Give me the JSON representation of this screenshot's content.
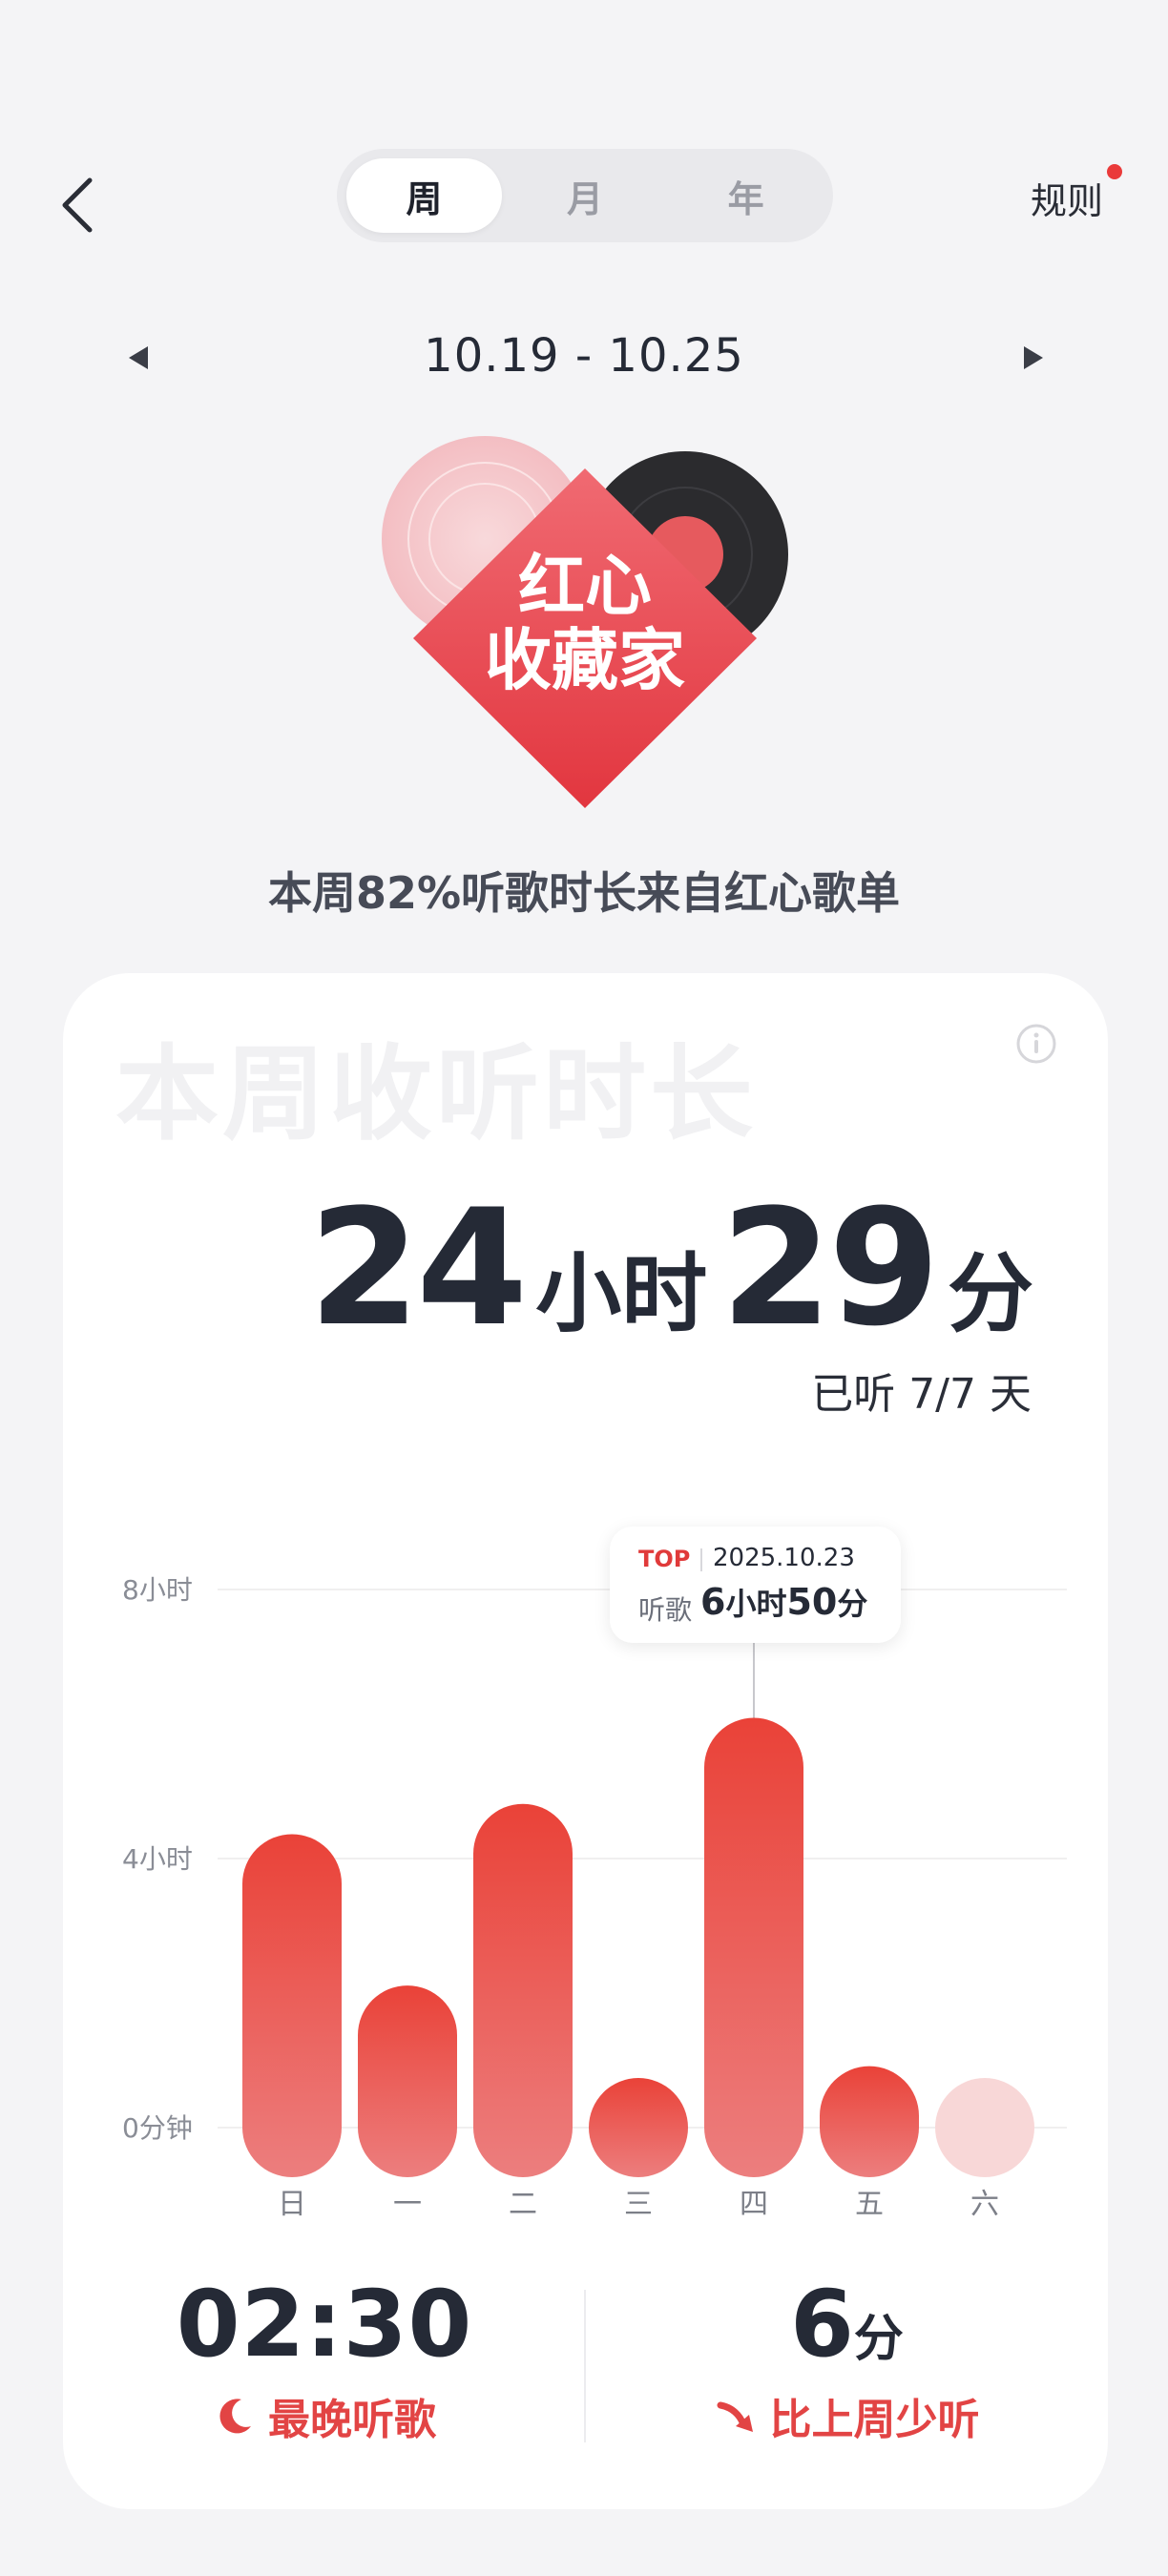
{
  "header": {
    "tabs": [
      {
        "label": "周",
        "active": true
      },
      {
        "label": "月",
        "active": false
      },
      {
        "label": "年",
        "active": false
      }
    ],
    "rules_label": "规则",
    "rules_has_notification": true
  },
  "date_nav": {
    "range": "10.19 - 10.25"
  },
  "badge": {
    "line1": "红心",
    "line2": "收藏家"
  },
  "summary_text": "本周82%听歌时长来自红心歌单",
  "card": {
    "watermark_title": "本周收听时长",
    "total_hours": "24",
    "hours_unit": "小时",
    "total_minutes": "29",
    "minutes_unit": "分",
    "days_listened": "已听 7/7 天",
    "tooltip": {
      "tag": "TOP",
      "date": "2025.10.23",
      "label": "听歌",
      "value_hours": "6",
      "hours_unit": "小时",
      "value_minutes": "50",
      "minutes_unit": "分"
    },
    "latest_time": "02:30",
    "latest_label": "最晚听歌",
    "diff_value": "6",
    "diff_unit": "分",
    "diff_label": "比上周少听"
  },
  "colors": {
    "accent": "#E84545",
    "bar_top": "#EA4238",
    "bar_bottom": "#EC7E7E",
    "bar_faded": "#F8D7D7",
    "text_dark": "#252A36"
  },
  "chart_data": {
    "type": "bar",
    "categories": [
      "日",
      "一",
      "二",
      "三",
      "四",
      "五",
      "六"
    ],
    "values": [
      5.1,
      2.85,
      5.55,
      1.45,
      6.83,
      1.65,
      1.3
    ],
    "y_tick_labels": [
      "0分钟",
      "4小时",
      "8小时"
    ],
    "y_ticks": [
      0,
      4,
      8
    ],
    "ylim": [
      0,
      8
    ],
    "unit": "小时",
    "highlight_index": 4,
    "faded_index": 6,
    "grid": true
  }
}
